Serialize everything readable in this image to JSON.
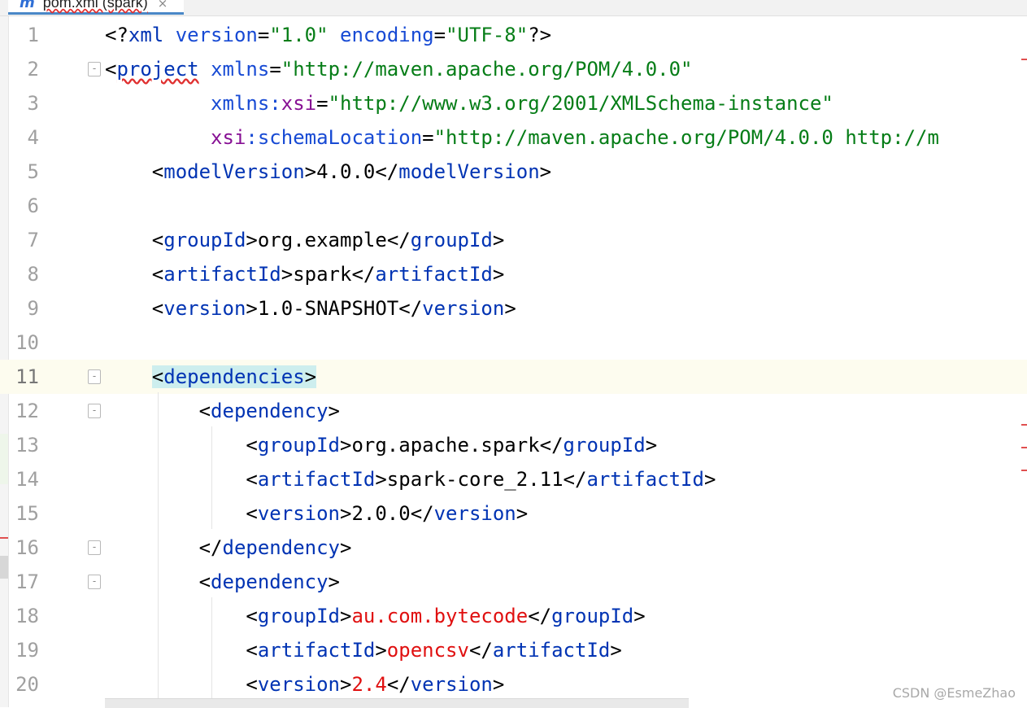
{
  "tab": {
    "icon": "maven-icon",
    "icon_glyph": "m",
    "title": "pom.xml (spark)",
    "close": "×"
  },
  "lines": [
    {
      "n": "1",
      "tokens": [
        {
          "c": "p",
          "t": "<?"
        },
        {
          "c": "tg",
          "t": "xml "
        },
        {
          "c": "at",
          "t": "version"
        },
        {
          "c": "p",
          "t": "="
        },
        {
          "c": "st",
          "t": "\"1.0\""
        },
        {
          "c": "p",
          "t": " "
        },
        {
          "c": "at",
          "t": "encoding"
        },
        {
          "c": "p",
          "t": "="
        },
        {
          "c": "st",
          "t": "\"UTF-8\""
        },
        {
          "c": "p",
          "t": "?>"
        }
      ]
    },
    {
      "n": "2",
      "fold": "-",
      "tokens": [
        {
          "c": "p",
          "t": "<"
        },
        {
          "c": "tg wavy",
          "t": "project"
        },
        {
          "c": "p",
          "t": " "
        },
        {
          "c": "at",
          "t": "xmlns"
        },
        {
          "c": "p",
          "t": "="
        },
        {
          "c": "st",
          "t": "\"http://maven.apache.org/POM/4.0.0\""
        }
      ]
    },
    {
      "n": "3",
      "tokens": [
        {
          "c": "p",
          "t": "         "
        },
        {
          "c": "at",
          "t": "xmlns:"
        },
        {
          "c": "ns",
          "t": "xsi"
        },
        {
          "c": "p",
          "t": "="
        },
        {
          "c": "st",
          "t": "\"http://www.w3.org/2001/XMLSchema-instance\""
        }
      ]
    },
    {
      "n": "4",
      "tokens": [
        {
          "c": "p",
          "t": "         "
        },
        {
          "c": "ns",
          "t": "xsi"
        },
        {
          "c": "at",
          "t": ":schemaLocation"
        },
        {
          "c": "p",
          "t": "="
        },
        {
          "c": "st",
          "t": "\"http://maven.apache.org/POM/4.0.0 http://m"
        }
      ]
    },
    {
      "n": "5",
      "tokens": [
        {
          "c": "p",
          "t": "    <"
        },
        {
          "c": "tg",
          "t": "modelVersion"
        },
        {
          "c": "p",
          "t": ">"
        },
        {
          "c": "tx",
          "t": "4.0.0"
        },
        {
          "c": "p",
          "t": "</"
        },
        {
          "c": "tg",
          "t": "modelVersion"
        },
        {
          "c": "p",
          "t": ">"
        }
      ]
    },
    {
      "n": "6",
      "tokens": []
    },
    {
      "n": "7",
      "tokens": [
        {
          "c": "p",
          "t": "    <"
        },
        {
          "c": "tg",
          "t": "groupId"
        },
        {
          "c": "p",
          "t": ">"
        },
        {
          "c": "tx",
          "t": "org.example"
        },
        {
          "c": "p",
          "t": "</"
        },
        {
          "c": "tg",
          "t": "groupId"
        },
        {
          "c": "p",
          "t": ">"
        }
      ]
    },
    {
      "n": "8",
      "tokens": [
        {
          "c": "p",
          "t": "    <"
        },
        {
          "c": "tg",
          "t": "artifactId"
        },
        {
          "c": "p",
          "t": ">"
        },
        {
          "c": "tx",
          "t": "spark"
        },
        {
          "c": "p",
          "t": "</"
        },
        {
          "c": "tg",
          "t": "artifactId"
        },
        {
          "c": "p",
          "t": ">"
        }
      ]
    },
    {
      "n": "9",
      "tokens": [
        {
          "c": "p",
          "t": "    <"
        },
        {
          "c": "tg",
          "t": "version"
        },
        {
          "c": "p",
          "t": ">"
        },
        {
          "c": "tx",
          "t": "1.0-SNAPSHOT"
        },
        {
          "c": "p",
          "t": "</"
        },
        {
          "c": "tg",
          "t": "version"
        },
        {
          "c": "p",
          "t": ">"
        }
      ]
    },
    {
      "n": "10",
      "tokens": []
    },
    {
      "n": "11",
      "fold": "-",
      "current": true,
      "tokens": [
        {
          "c": "p",
          "t": "    "
        },
        {
          "c": "p tag-hl",
          "t": "<"
        },
        {
          "c": "tg tag-hl",
          "t": "dependencies"
        },
        {
          "c": "p tag-hl",
          "t": ">"
        }
      ]
    },
    {
      "n": "12",
      "fold": "-",
      "tokens": [
        {
          "c": "p",
          "t": "        <"
        },
        {
          "c": "tg",
          "t": "dependency"
        },
        {
          "c": "p",
          "t": ">"
        }
      ]
    },
    {
      "n": "13",
      "tokens": [
        {
          "c": "p",
          "t": "            <"
        },
        {
          "c": "tg",
          "t": "groupId"
        },
        {
          "c": "p",
          "t": ">"
        },
        {
          "c": "tx",
          "t": "org.apache.spark"
        },
        {
          "c": "p",
          "t": "</"
        },
        {
          "c": "tg",
          "t": "groupId"
        },
        {
          "c": "p",
          "t": ">"
        }
      ]
    },
    {
      "n": "14",
      "tokens": [
        {
          "c": "p",
          "t": "            <"
        },
        {
          "c": "tg",
          "t": "artifactId"
        },
        {
          "c": "p",
          "t": ">"
        },
        {
          "c": "tx",
          "t": "spark-core_2.11"
        },
        {
          "c": "p",
          "t": "</"
        },
        {
          "c": "tg",
          "t": "artifactId"
        },
        {
          "c": "p",
          "t": ">"
        }
      ]
    },
    {
      "n": "15",
      "tokens": [
        {
          "c": "p",
          "t": "            <"
        },
        {
          "c": "tg",
          "t": "version"
        },
        {
          "c": "p",
          "t": ">"
        },
        {
          "c": "tx",
          "t": "2.0.0"
        },
        {
          "c": "p",
          "t": "</"
        },
        {
          "c": "tg",
          "t": "version"
        },
        {
          "c": "p",
          "t": ">"
        }
      ]
    },
    {
      "n": "16",
      "fold": "-",
      "tokens": [
        {
          "c": "p",
          "t": "        </"
        },
        {
          "c": "tg",
          "t": "dependency"
        },
        {
          "c": "p",
          "t": ">"
        }
      ]
    },
    {
      "n": "17",
      "fold": "-",
      "tokens": [
        {
          "c": "p",
          "t": "        <"
        },
        {
          "c": "tg",
          "t": "dependency"
        },
        {
          "c": "p",
          "t": ">"
        }
      ]
    },
    {
      "n": "18",
      "tokens": [
        {
          "c": "p",
          "t": "            <"
        },
        {
          "c": "tg",
          "t": "groupId"
        },
        {
          "c": "p",
          "t": ">"
        },
        {
          "c": "err",
          "t": "au.com.bytecode"
        },
        {
          "c": "p",
          "t": "</"
        },
        {
          "c": "tg",
          "t": "groupId"
        },
        {
          "c": "p",
          "t": ">"
        }
      ]
    },
    {
      "n": "19",
      "tokens": [
        {
          "c": "p",
          "t": "            <"
        },
        {
          "c": "tg",
          "t": "artifactId"
        },
        {
          "c": "p",
          "t": ">"
        },
        {
          "c": "err",
          "t": "opencsv"
        },
        {
          "c": "p",
          "t": "</"
        },
        {
          "c": "tg",
          "t": "artifactId"
        },
        {
          "c": "p",
          "t": ">"
        }
      ]
    },
    {
      "n": "20",
      "tokens": [
        {
          "c": "p",
          "t": "            <"
        },
        {
          "c": "tg",
          "t": "version"
        },
        {
          "c": "p",
          "t": ">"
        },
        {
          "c": "err",
          "t": "2.4"
        },
        {
          "c": "p",
          "t": "</"
        },
        {
          "c": "tg",
          "t": "version"
        },
        {
          "c": "p",
          "t": ">"
        }
      ]
    }
  ],
  "watermark": "CSDN @EsmeZhao",
  "colors": {
    "tag": "#0033b3",
    "attribute": "#174ad4",
    "namespace": "#871094",
    "string": "#067d17",
    "error": "#e01010",
    "current_line": "#fdfcef",
    "match_highlight": "#cdeeee"
  }
}
